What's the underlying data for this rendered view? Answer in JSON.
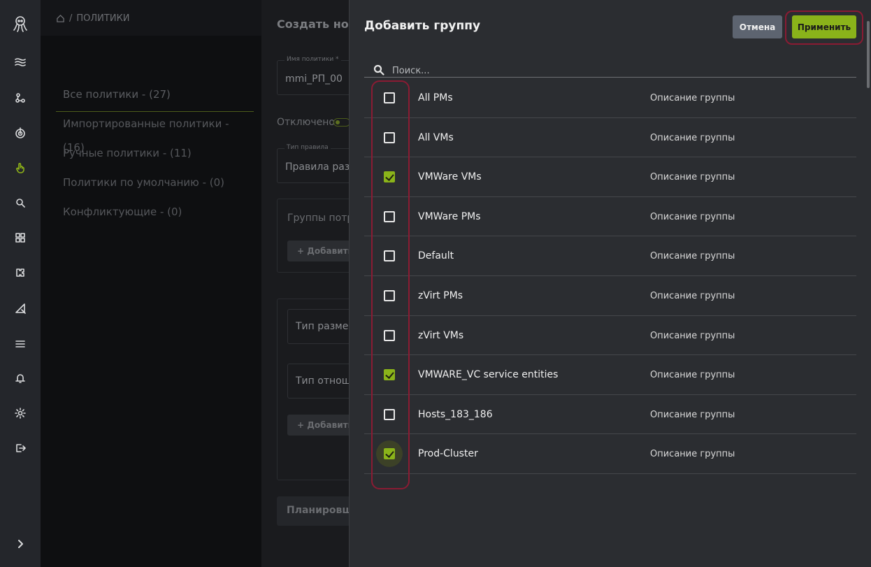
{
  "breadcrumb": {
    "path": "ПОЛИТИКИ",
    "separator": "/"
  },
  "sidebar": {
    "icons": [
      "logo-octopus-icon",
      "waves-icon",
      "nodes-icon",
      "radar-icon",
      "hand-pointer-icon",
      "search-icon",
      "dashboard-icon",
      "puzzle-icon",
      "ruler-pencil-icon",
      "layers-icon",
      "bell-icon",
      "gear-icon",
      "logout-icon",
      "chevron-right-icon"
    ]
  },
  "policies": {
    "filters": [
      "Все политики - (27)",
      "Импортированные политики - (16)",
      "Ручные политики - (11)",
      "Политики по умолчанию - (0)",
      "Конфликтующие - (0)"
    ]
  },
  "create_panel": {
    "title": "Создать нов",
    "name_label": "Имя политики *",
    "name_value": "mmi_РП_00",
    "toggle_label": "Отключено",
    "rule_type_label": "Тип правила",
    "rule_type_value": "Правила разм",
    "consumer_groups_label": "Группы потреб",
    "add_button": "+ Добавить г",
    "placement_type": "Тип размеш",
    "relation_type": "Тип отношен",
    "add_button_2": "+ Добавить г",
    "planner": "Планировщ"
  },
  "dialog": {
    "title": "Добавить группу",
    "cancel": "Отмена",
    "apply": "Применить",
    "search_placeholder": "Поиск...",
    "groups": [
      {
        "name": "All PMs",
        "description": "Описание группы",
        "checked": false
      },
      {
        "name": "All VMs",
        "description": "Описание группы",
        "checked": false
      },
      {
        "name": "VMWare VMs",
        "description": "Описание группы",
        "checked": true
      },
      {
        "name": "VMWare PMs",
        "description": "Описание группы",
        "checked": false
      },
      {
        "name": "Default",
        "description": "Описание группы",
        "checked": false
      },
      {
        "name": "zVirt PMs",
        "description": "Описание группы",
        "checked": false
      },
      {
        "name": "zVirt VMs",
        "description": "Описание группы",
        "checked": false
      },
      {
        "name": "VMWARE_VC service entities",
        "description": "Описание группы",
        "checked": true
      },
      {
        "name": "Hosts_183_186",
        "description": "Описание группы",
        "checked": false
      },
      {
        "name": "Prod-Cluster",
        "description": "Описание группы",
        "checked": true,
        "focused": true
      }
    ]
  },
  "colors": {
    "accent": "#8ab31a",
    "highlight": "#8a1b33",
    "drawer_bg": "#2b2d31"
  }
}
